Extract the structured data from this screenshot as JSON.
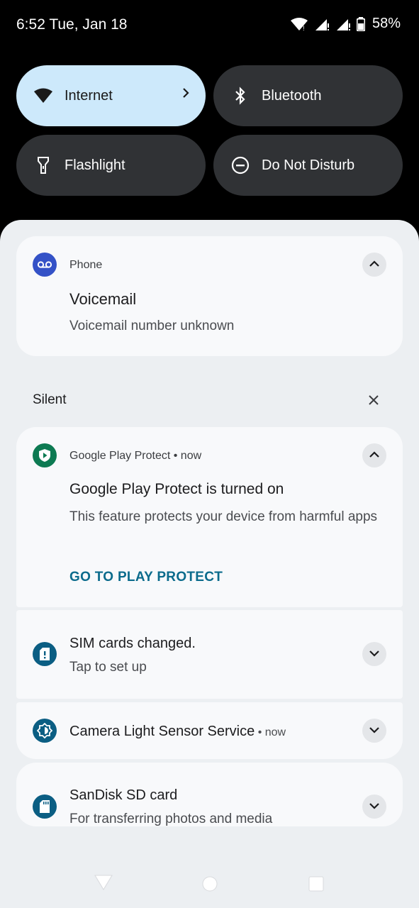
{
  "status": {
    "time": "6:52 Tue, Jan 18",
    "battery": "58%"
  },
  "tiles": [
    {
      "label": "Internet",
      "icon": "wifi-icon",
      "active": true
    },
    {
      "label": "Bluetooth",
      "icon": "bluetooth-icon",
      "active": false
    },
    {
      "label": "Flashlight",
      "icon": "flashlight-icon",
      "active": false
    },
    {
      "label": "Do Not Disturb",
      "icon": "do-not-disturb-icon",
      "active": false
    }
  ],
  "notifications": {
    "phone": {
      "app": "Phone",
      "title": "Voicemail",
      "body": "Voicemail number unknown"
    },
    "silent_label": "Silent",
    "play_protect": {
      "app": "Google Play Protect",
      "time": "now",
      "title": "Google Play Protect is turned on",
      "body": "This feature protects your device from harmful apps",
      "action": "GO TO PLAY PROTECT"
    },
    "sim": {
      "title": "SIM cards changed.",
      "body": "Tap to set up"
    },
    "camera": {
      "title": "Camera Light Sensor Service",
      "time": "now"
    },
    "sdcard": {
      "title": "SanDisk SD card",
      "body": "For transferring photos and media"
    }
  },
  "colors": {
    "tile_active": "#cde9fb",
    "tile_inactive": "#303235",
    "accent": "#0b6b8c",
    "phone_icon": "#3452c7",
    "play_protect_icon": "#0d7a52"
  }
}
